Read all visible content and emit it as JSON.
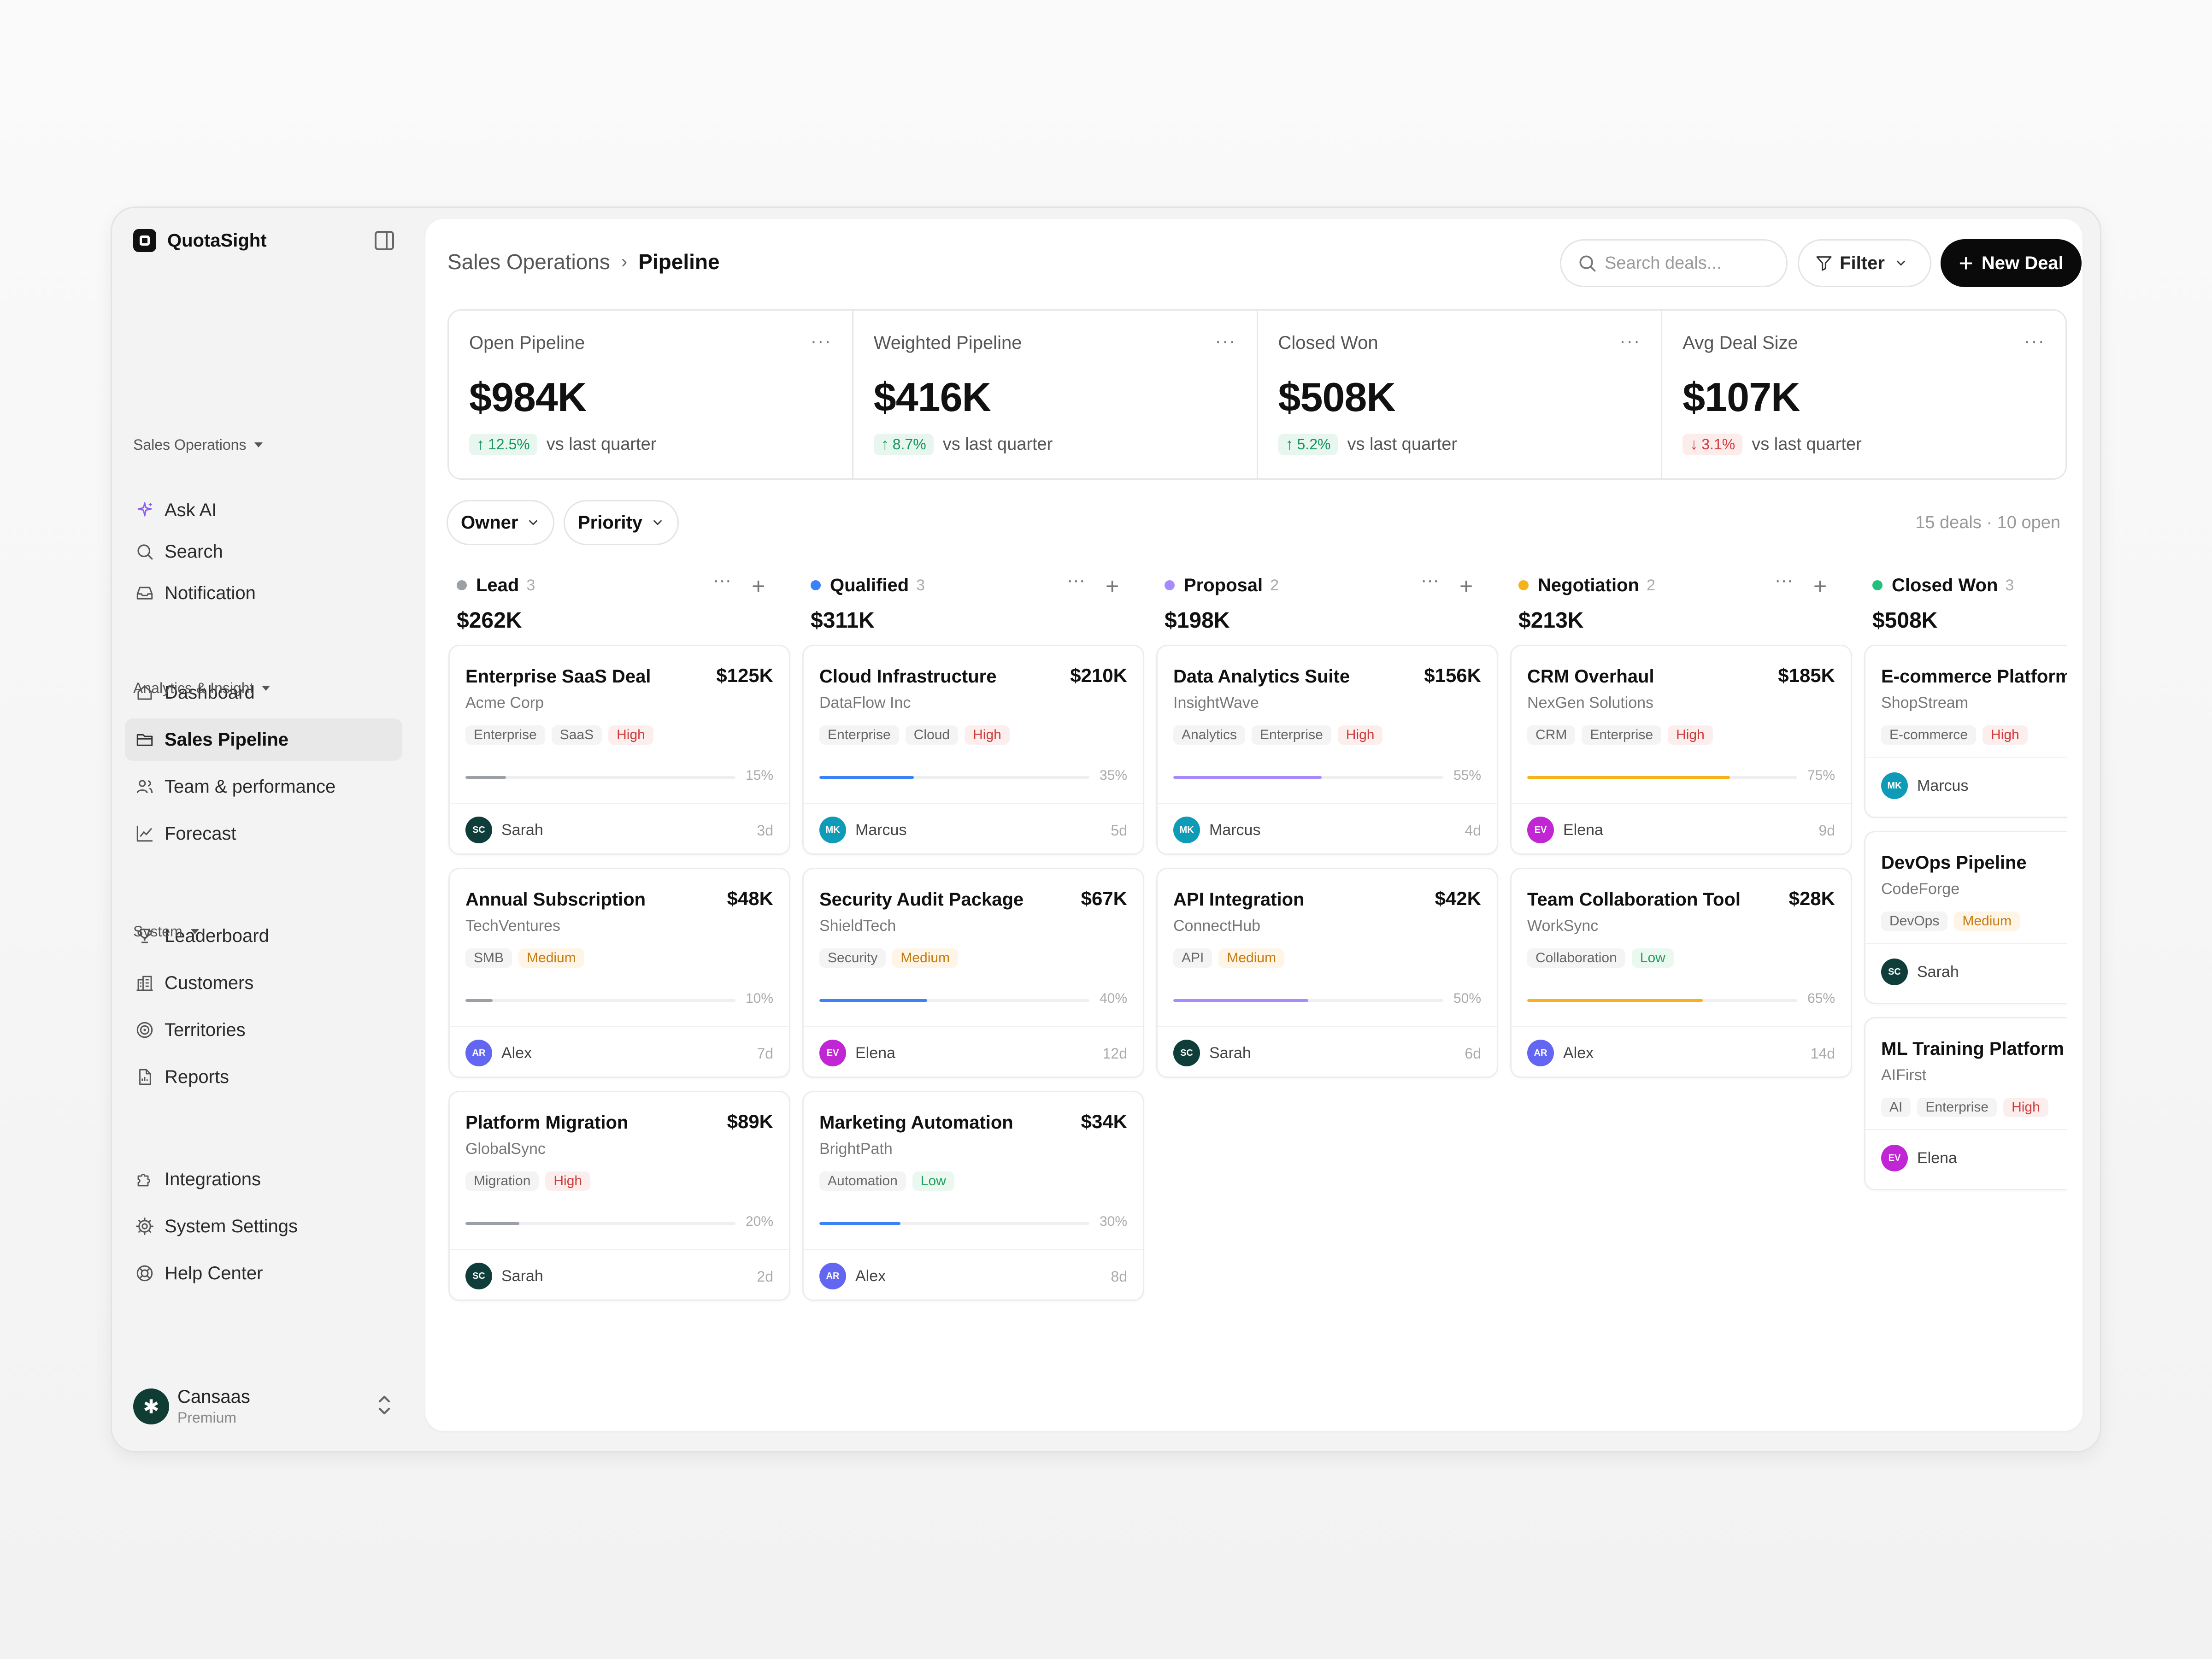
{
  "app": {
    "name": "QuotaSight"
  },
  "nav_top": [
    {
      "label": "Ask AI",
      "icon": "sparkle-icon"
    },
    {
      "label": "Search",
      "icon": "search-icon"
    },
    {
      "label": "Notification",
      "icon": "inbox-icon"
    }
  ],
  "sections": {
    "sales": "Sales Operations",
    "analytics": "Analytics & Insight",
    "system": "System"
  },
  "nav_sales": [
    {
      "label": "Dashboard",
      "icon": "home-icon"
    },
    {
      "label": "Sales Pipeline",
      "icon": "folder-icon",
      "active": true
    },
    {
      "label": "Team & performance",
      "icon": "users-icon"
    },
    {
      "label": "Forecast",
      "icon": "chart-line-icon"
    }
  ],
  "nav_analytics": [
    {
      "label": "Leaderboard",
      "icon": "trophy-icon"
    },
    {
      "label": "Customers",
      "icon": "building-icon"
    },
    {
      "label": "Territories",
      "icon": "target-icon"
    },
    {
      "label": "Reports",
      "icon": "file-icon"
    }
  ],
  "nav_system": [
    {
      "label": "Integrations",
      "icon": "puzzle-icon"
    },
    {
      "label": "System Settings",
      "icon": "gear-icon"
    },
    {
      "label": "Help Center",
      "icon": "lifebuoy-icon"
    }
  ],
  "user": {
    "name": "Cansaas",
    "plan": "Premium"
  },
  "header": {
    "breadcrumb_parent": "Sales Operations",
    "breadcrumb_current": "Pipeline",
    "search_placeholder": "Search deals...",
    "filter_label": "Filter",
    "new_deal_label": "New Deal"
  },
  "kpis": [
    {
      "title": "Open Pipeline",
      "value": "$984K",
      "change": "12.5%",
      "direction": "up",
      "sub": "vs last quarter"
    },
    {
      "title": "Weighted Pipeline",
      "value": "$416K",
      "change": "8.7%",
      "direction": "up",
      "sub": "vs last quarter"
    },
    {
      "title": "Closed Won",
      "value": "$508K",
      "change": "5.2%",
      "direction": "up",
      "sub": "vs last quarter"
    },
    {
      "title": "Avg Deal Size",
      "value": "$107K",
      "change": "3.1%",
      "direction": "down",
      "sub": "vs last quarter"
    }
  ],
  "filters": {
    "owner": "Owner",
    "priority": "Priority",
    "count": "15 deals · 10 open"
  },
  "colors": {
    "lead": "#9aa0a6",
    "qualified": "#3b82f6",
    "proposal": "#a78bfa",
    "negotiation": "#f5b21b",
    "won": "#22c07a"
  },
  "columns": [
    {
      "name": "Lead",
      "count": "3",
      "total": "$262K",
      "color": "#9aa0a6",
      "cards": [
        {
          "title": "Enterprise SaaS Deal",
          "amount": "$125K",
          "company": "Acme Corp",
          "tags": [
            "Enterprise",
            "SaaS"
          ],
          "priority": "High",
          "progress": 15,
          "pct": "15%",
          "initials": "SC",
          "owner": "Sarah",
          "age": "3d"
        },
        {
          "title": "Annual Subscription",
          "amount": "$48K",
          "company": "TechVentures",
          "tags": [
            "SMB"
          ],
          "priority": "Medium",
          "progress": 10,
          "pct": "10%",
          "initials": "AR",
          "owner": "Alex",
          "age": "7d"
        },
        {
          "title": "Platform Migration",
          "amount": "$89K",
          "company": "GlobalSync",
          "tags": [
            "Migration"
          ],
          "priority": "High",
          "progress": 20,
          "pct": "20%",
          "initials": "SC",
          "owner": "Sarah",
          "age": "2d"
        }
      ]
    },
    {
      "name": "Qualified",
      "count": "3",
      "total": "$311K",
      "color": "#3b82f6",
      "cards": [
        {
          "title": "Cloud Infrastructure",
          "amount": "$210K",
          "company": "DataFlow Inc",
          "tags": [
            "Enterprise",
            "Cloud"
          ],
          "priority": "High",
          "progress": 35,
          "pct": "35%",
          "initials": "MK",
          "owner": "Marcus",
          "age": "5d"
        },
        {
          "title": "Security Audit Package",
          "amount": "$67K",
          "company": "ShieldTech",
          "tags": [
            "Security"
          ],
          "priority": "Medium",
          "progress": 40,
          "pct": "40%",
          "initials": "EV",
          "owner": "Elena",
          "age": "12d"
        },
        {
          "title": "Marketing Automation",
          "amount": "$34K",
          "company": "BrightPath",
          "tags": [
            "Automation"
          ],
          "priority": "Low",
          "progress": 30,
          "pct": "30%",
          "initials": "AR",
          "owner": "Alex",
          "age": "8d"
        }
      ]
    },
    {
      "name": "Proposal",
      "count": "2",
      "total": "$198K",
      "color": "#a78bfa",
      "cards": [
        {
          "title": "Data Analytics Suite",
          "amount": "$156K",
          "company": "InsightWave",
          "tags": [
            "Analytics",
            "Enterprise"
          ],
          "priority": "High",
          "progress": 55,
          "pct": "55%",
          "initials": "MK",
          "owner": "Marcus",
          "age": "4d"
        },
        {
          "title": "API Integration",
          "amount": "$42K",
          "company": "ConnectHub",
          "tags": [
            "API"
          ],
          "priority": "Medium",
          "progress": 50,
          "pct": "50%",
          "initials": "SC",
          "owner": "Sarah",
          "age": "6d"
        }
      ]
    },
    {
      "name": "Negotiation",
      "count": "2",
      "total": "$213K",
      "color": "#f5b21b",
      "cards": [
        {
          "title": "CRM Overhaul",
          "amount": "$185K",
          "company": "NexGen Solutions",
          "tags": [
            "CRM",
            "Enterprise"
          ],
          "priority": "High",
          "progress": 75,
          "pct": "75%",
          "initials": "EV",
          "owner": "Elena",
          "age": "9d"
        },
        {
          "title": "Team Collaboration Tool",
          "amount": "$28K",
          "company": "WorkSync",
          "tags": [
            "Collaboration"
          ],
          "priority": "Low",
          "progress": 65,
          "pct": "65%",
          "initials": "AR",
          "owner": "Alex",
          "age": "14d"
        }
      ]
    },
    {
      "name": "Closed Won",
      "count": "3",
      "total": "$508K",
      "color": "#22c07a",
      "cards": [
        {
          "title": "E-commerce Platform",
          "company": "ShopStream",
          "tags": [
            "E-commerce"
          ],
          "priority": "High",
          "initials": "MK",
          "owner": "Marcus"
        },
        {
          "title": "DevOps Pipeline",
          "company": "CodeForge",
          "tags": [
            "DevOps"
          ],
          "priority": "Medium",
          "initials": "SC",
          "owner": "Sarah"
        },
        {
          "title": "ML Training Platform",
          "company": "AIFirst",
          "tags": [
            "AI",
            "Enterprise"
          ],
          "priority": "High",
          "initials": "EV",
          "owner": "Elena"
        }
      ]
    }
  ]
}
